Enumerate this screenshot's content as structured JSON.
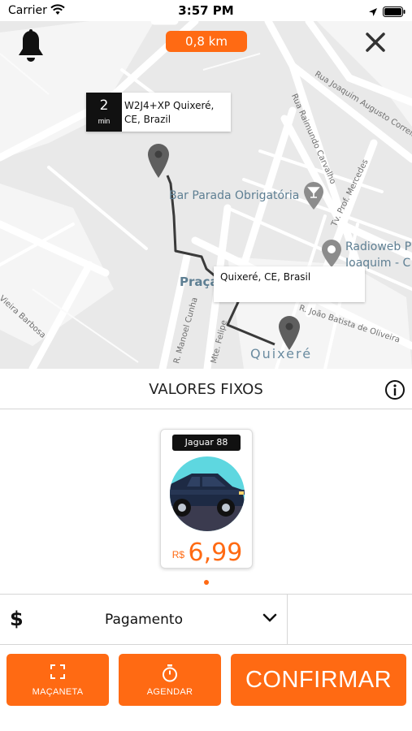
{
  "status_bar": {
    "carrier": "Carrier",
    "time": "3:57 PM"
  },
  "map": {
    "distance": "0,8 km",
    "origin": {
      "eta_value": "2",
      "eta_unit": "min",
      "address": "W2J4+XP Quixeré, CE, Brazil"
    },
    "destination": {
      "address": "Quixeré, CE, Brasil"
    },
    "pois": [
      "Bar Parada Obrigatória",
      "Radioweb Pr",
      "Joaquim - C"
    ],
    "town": "Quixeré",
    "square": "Praça",
    "streets": [
      "Rua Joaquim Augusto Correia",
      "Rua Raimundo Carvalho",
      "Tv. Prof. Mercedes",
      "R. João Batista de Oliveira",
      "Rua Manoel Cunha",
      "R. Manoel Cunha",
      "Mte. Felipe",
      "Vieira Barbosa"
    ]
  },
  "fixed_values": {
    "title": "VALORES FIXOS"
  },
  "vehicle": {
    "name": "Jaguar 88",
    "currency": "R$",
    "price": "6,99"
  },
  "payment": {
    "label": "Pagamento"
  },
  "buttons": {
    "handle": "MAÇANETA",
    "schedule": "AGENDAR",
    "confirm": "CONFIRMAR"
  },
  "colors": {
    "accent": "#ff6a13",
    "map_bg": "#e9e9e9",
    "route": "#3a3a3a"
  }
}
